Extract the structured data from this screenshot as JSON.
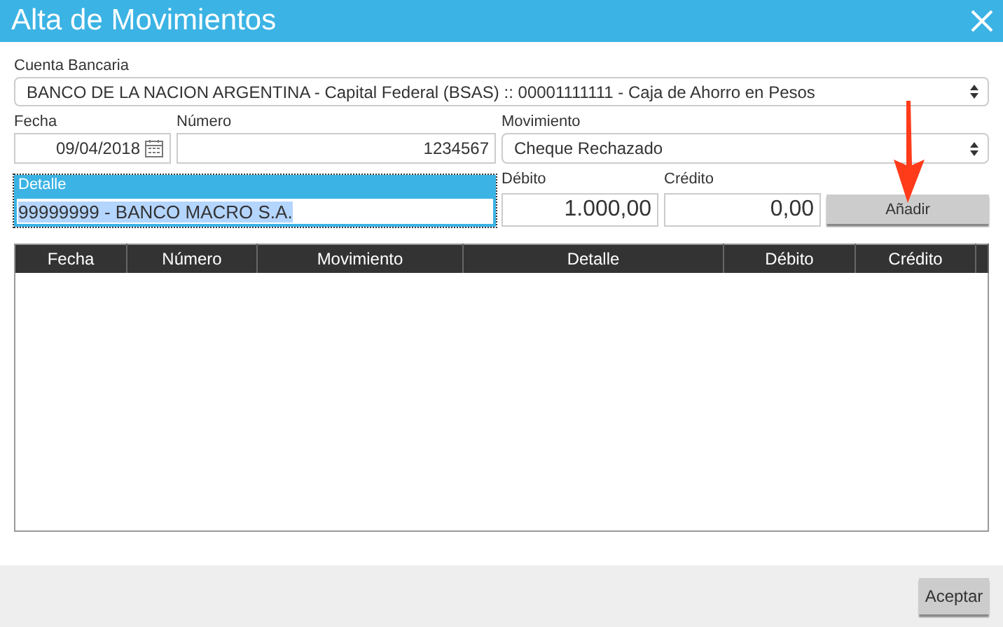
{
  "window": {
    "title": "Alta de Movimientos"
  },
  "cuenta": {
    "label": "Cuenta Bancaria",
    "value": "BANCO DE LA NACION ARGENTINA - Capital Federal (BSAS) :: 00001111111 - Caja de Ahorro en Pesos"
  },
  "fecha": {
    "label": "Fecha",
    "value": "09/04/2018"
  },
  "numero": {
    "label": "Número",
    "value": "1234567"
  },
  "movimiento": {
    "label": "Movimiento",
    "value": "Cheque Rechazado"
  },
  "detalle": {
    "label": "Detalle",
    "value": "99999999 - BANCO MACRO S.A.",
    "focused": true
  },
  "debito": {
    "label": "Débito",
    "value": "1.000,00"
  },
  "credito": {
    "label": "Crédito",
    "value": "0,00"
  },
  "add_button": "Añadir",
  "table": {
    "columns": [
      "Fecha",
      "Número",
      "Movimiento",
      "Detalle",
      "Débito",
      "Crédito"
    ]
  },
  "accept_button": "Aceptar"
}
